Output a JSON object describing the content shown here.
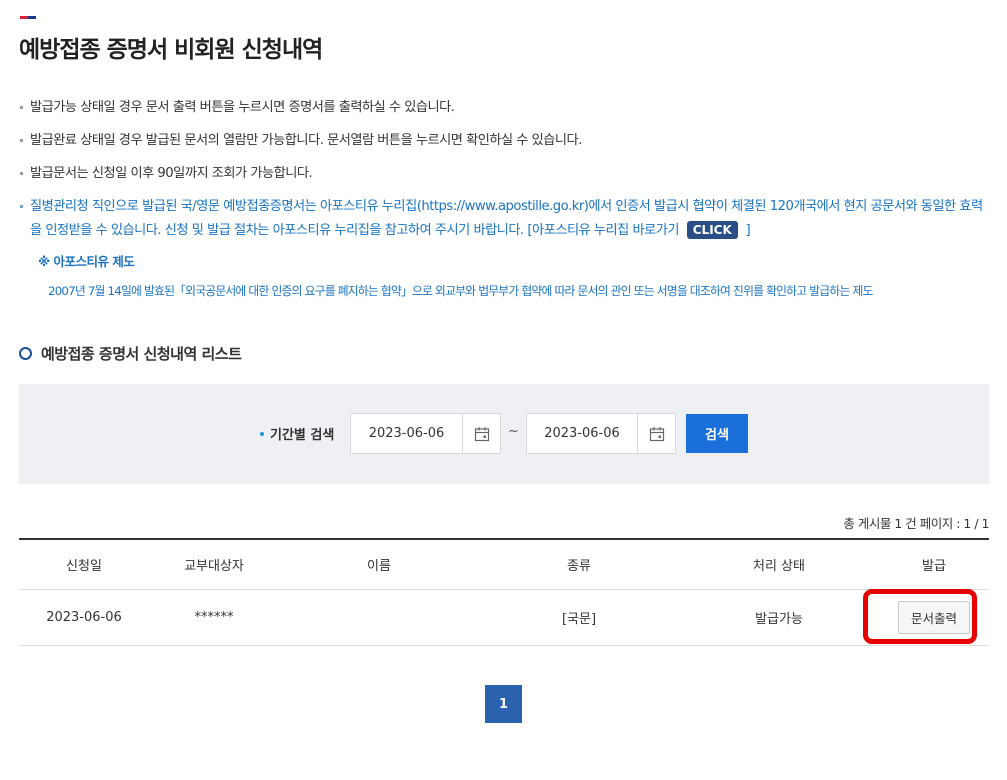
{
  "header": {
    "title": "예방접종 증명서 비회원 신청내역"
  },
  "notices": [
    "발급가능 상태일 경우 문서 출력 버튼을 누르시면 증명서를 출력하실 수 있습니다.",
    "발급완료 상태일 경우 발급된 문서의 열람만 가능합니다. 문서열람 버튼을 누르시면 확인하실 수 있습니다.",
    "발급문서는 신청일 이후 90일까지 조회가 가능합니다."
  ],
  "apostille": {
    "text_before": "질병관리청 직인으로 발급된 국/영문 예방접종증명서는 아포스티유 누리집(https://www.apostille.go.kr)에서 인증서 발급시 협약이 체결된 120개국에서 현지 공문서와 동일한 효력을 인정받을 수 있습니다. 신청 및 발급 절차는 아포스티유 누리집을 참고하여 주시기 바랍니다. [아포스티유 누리집 바로가기",
    "click_label": "CLICK",
    "text_after": "]",
    "sub_title": "※ 아포스티유 제도",
    "sub_desc": "2007년 7월 14일에 발효된「외국공문서에 대한 인증의 요구를 폐지하는 협약」으로 외교부와 법무부가 협약에 따라 문서의 관인 또는 서명을 대조하여 진위를 확인하고 발급하는 제도"
  },
  "list": {
    "title": "예방접종 증명서 신청내역 리스트"
  },
  "search": {
    "label": "기간별 검색",
    "start_date": "2023-06-06",
    "tilde": "~",
    "end_date": "2023-06-06",
    "button": "검색"
  },
  "count": {
    "text": "총 게시물 1 건   페이지 : 1 / 1"
  },
  "table": {
    "headers": [
      "신청일",
      "교부대상자",
      "이름",
      "종류",
      "처리 상태",
      "발급"
    ],
    "rows": [
      {
        "date": "2023-06-06",
        "recipient": "******",
        "name": "",
        "kind": "[국문]",
        "status": "발급가능",
        "action": "문서출력"
      }
    ]
  },
  "pagination": {
    "current": "1"
  },
  "colors": {
    "accent_blue": "#1a6fd8",
    "link_blue": "#1a73c0",
    "highlight": "#e60000",
    "page_active": "#2a62b0"
  }
}
